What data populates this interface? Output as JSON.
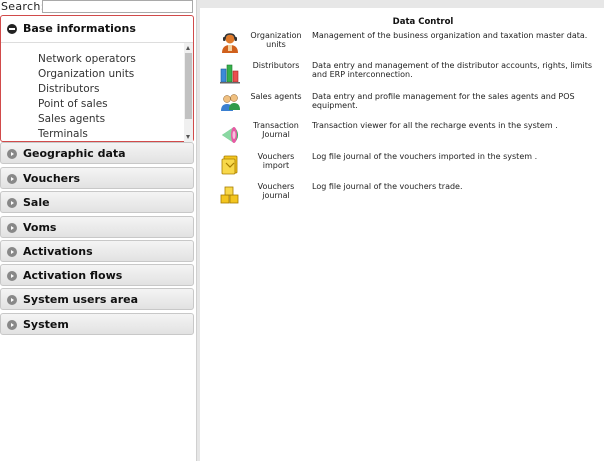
{
  "search": {
    "label": "Search:",
    "value": ""
  },
  "sidebar": {
    "open_section": {
      "title": "Base informations",
      "items": [
        "Network operators",
        "Organization units",
        "Distributors",
        "Point of sales",
        "Sales agents",
        "Terminals"
      ]
    },
    "sections": [
      "Geographic data",
      "Vouchers",
      "Sale",
      "Voms",
      "Activations",
      "Activation flows",
      "System users area",
      "System"
    ]
  },
  "main": {
    "title": "Data Control",
    "rows": [
      {
        "icon": "organization-icon",
        "label": "Organization units",
        "desc": "Management of the business organization and taxation master data."
      },
      {
        "icon": "distributors-icon",
        "label": "Distributors",
        "desc": "Data entry and management of the distributor accounts, rights, limits and ERP interconnection."
      },
      {
        "icon": "sales-agents-icon",
        "label": "Sales agents",
        "desc": "Data entry and profile management for the sales agents and POS equipment."
      },
      {
        "icon": "transaction-journal-icon",
        "label": "Transaction Journal",
        "desc": "Transaction viewer for all the recharge events in the system ."
      },
      {
        "icon": "vouchers-import-icon",
        "label": "Vouchers import",
        "desc": "Log file journal of the vouchers imported in the system ."
      },
      {
        "icon": "vouchers-journal-icon",
        "label": "Vouchers journal",
        "desc": "Log file journal of the vouchers trade."
      }
    ]
  }
}
